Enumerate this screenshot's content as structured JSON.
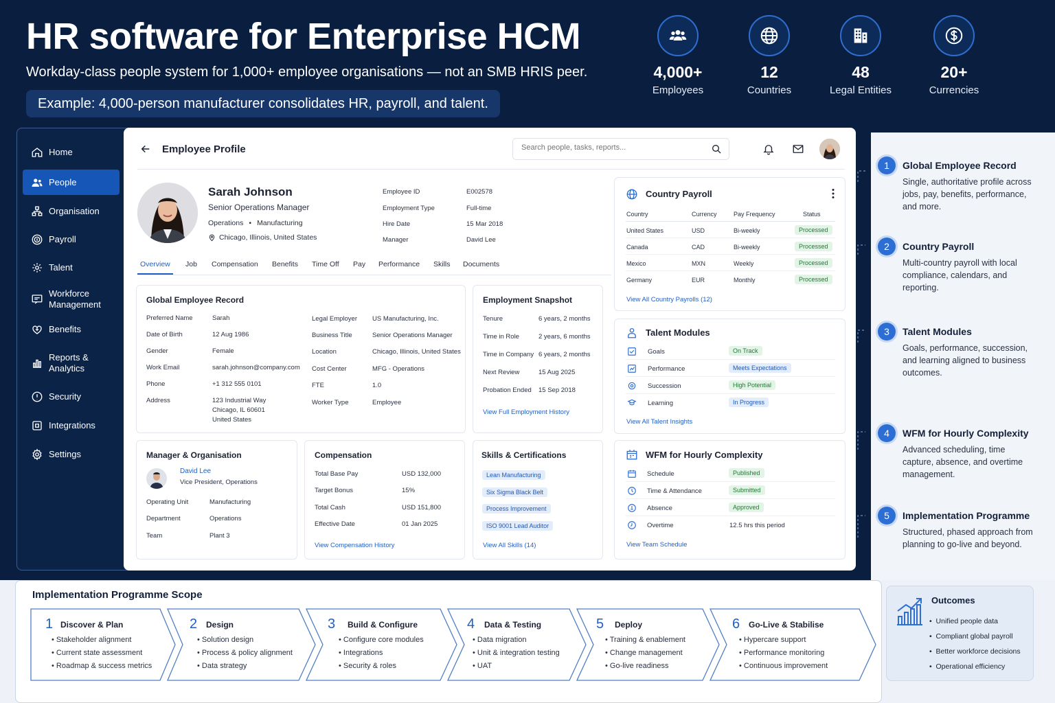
{
  "header": {
    "title": "HR software for Enterprise HCM",
    "subtitle": "Workday-class people system for 1,000+ employee organisations — not an SMB HRIS peer.",
    "example": "Example: 4,000-person manufacturer consolidates HR, payroll, and talent."
  },
  "stats": [
    {
      "value": "4,000+",
      "label": "Employees",
      "icon": "people-icon"
    },
    {
      "value": "12",
      "label": "Countries",
      "icon": "globe-icon"
    },
    {
      "value": "48",
      "label": "Legal Entities",
      "icon": "building-icon"
    },
    {
      "value": "20+",
      "label": "Currencies",
      "icon": "dollar-icon"
    }
  ],
  "sidebar": {
    "items": [
      {
        "label": "Home"
      },
      {
        "label": "People",
        "active": true
      },
      {
        "label": "Organisation"
      },
      {
        "label": "Payroll"
      },
      {
        "label": "Talent"
      },
      {
        "label": "Workforce Management"
      },
      {
        "label": "Benefits"
      },
      {
        "label": "Reports & Analytics"
      },
      {
        "label": "Security"
      },
      {
        "label": "Integrations"
      },
      {
        "label": "Settings"
      }
    ]
  },
  "topbar": {
    "title": "Employee Profile",
    "search_placeholder": "Search people, tasks, reports..."
  },
  "profile": {
    "name": "Sarah Johnson",
    "title": "Senior Operations Manager",
    "dept": "Operations",
    "dept2": "Manufacturing",
    "location": "Chicago, Illinois, United States",
    "fields": [
      {
        "k": "Employee ID",
        "v": "E002578"
      },
      {
        "k": "Employment Type",
        "v": "Full-time"
      },
      {
        "k": "Hire Date",
        "v": "15 Mar 2018"
      },
      {
        "k": "Manager",
        "v": "David Lee"
      }
    ]
  },
  "tabs": [
    "Overview",
    "Job",
    "Compensation",
    "Benefits",
    "Time Off",
    "Pay",
    "Performance",
    "Skills",
    "Documents"
  ],
  "global_record": {
    "title": "Global Employee Record",
    "left": [
      {
        "k": "Preferred Name",
        "v": "Sarah"
      },
      {
        "k": "Date of Birth",
        "v": "12 Aug 1986"
      },
      {
        "k": "Gender",
        "v": "Female"
      },
      {
        "k": "Work Email",
        "v": "sarah.johnson@company.com"
      },
      {
        "k": "Phone",
        "v": "+1 312 555 0101"
      },
      {
        "k": "Address",
        "v": "123 Industrial Way",
        "v2": "Chicago, IL 60601",
        "v3": "United States"
      }
    ],
    "right": [
      {
        "k": "Legal Employer",
        "v": "US Manufacturing, Inc."
      },
      {
        "k": "Business Title",
        "v": "Senior Operations Manager"
      },
      {
        "k": "Location",
        "v": "Chicago, Illinois, United States"
      },
      {
        "k": "Cost Center",
        "v": "MFG - Operations"
      },
      {
        "k": "FTE",
        "v": "1.0"
      },
      {
        "k": "Worker Type",
        "v": "Employee"
      }
    ]
  },
  "snapshot": {
    "title": "Employment Snapshot",
    "rows": [
      {
        "k": "Tenure",
        "v": "6 years, 2 months"
      },
      {
        "k": "Time in Role",
        "v": "2 years, 6 months"
      },
      {
        "k": "Time in Company",
        "v": "6 years, 2 months"
      },
      {
        "k": "Next Review",
        "v": "15 Aug 2025"
      },
      {
        "k": "Probation Ended",
        "v": "15 Sep 2018"
      }
    ],
    "link": "View Full Employment History"
  },
  "payroll": {
    "title": "Country Payroll",
    "headers": [
      "Country",
      "Currency",
      "Pay Frequency",
      "Status"
    ],
    "rows": [
      [
        "United States",
        "USD",
        "Bi-weekly",
        "Processed"
      ],
      [
        "Canada",
        "CAD",
        "Bi-weekly",
        "Processed"
      ],
      [
        "Mexico",
        "MXN",
        "Weekly",
        "Processed"
      ],
      [
        "Germany",
        "EUR",
        "Monthly",
        "Processed"
      ]
    ],
    "link": "View All Country Payrolls (12)"
  },
  "talent": {
    "title": "Talent Modules",
    "rows": [
      {
        "k": "Goals",
        "v": "On Track",
        "c": "green"
      },
      {
        "k": "Performance",
        "v": "Meets Expectations",
        "c": "blue"
      },
      {
        "k": "Succession",
        "v": "High Potential",
        "c": "green"
      },
      {
        "k": "Learning",
        "v": "In Progress",
        "c": "blue"
      }
    ],
    "link": "View All Talent Insights"
  },
  "manager": {
    "title": "Manager & Organisation",
    "name": "David Lee",
    "role": "Vice President, Operations",
    "rows": [
      {
        "k": "Operating Unit",
        "v": "Manufacturing"
      },
      {
        "k": "Department",
        "v": "Operations"
      },
      {
        "k": "Team",
        "v": "Plant 3"
      }
    ]
  },
  "compensation": {
    "title": "Compensation",
    "rows": [
      {
        "k": "Total Base Pay",
        "v": "USD 132,000"
      },
      {
        "k": "Target Bonus",
        "v": "15%"
      },
      {
        "k": "Total Cash",
        "v": "USD 151,800"
      },
      {
        "k": "Effective Date",
        "v": "01 Jan 2025"
      }
    ],
    "link": "View Compensation History"
  },
  "skills": {
    "title": "Skills & Certifications",
    "items": [
      "Lean Manufacturing",
      "Six Sigma Black Belt",
      "Process Improvement",
      "ISO 9001 Lead Auditor"
    ],
    "link": "View All Skills (14)"
  },
  "wfm": {
    "title": "WFM for Hourly Complexity",
    "rows": [
      {
        "k": "Schedule",
        "v": "Published",
        "c": "green"
      },
      {
        "k": "Time & Attendance",
        "v": "Submitted",
        "c": "green"
      },
      {
        "k": "Absence",
        "v": "Approved",
        "c": "green"
      },
      {
        "k": "Overtime",
        "v": "12.5 hrs this period",
        "c": "none"
      }
    ],
    "link": "View Team Schedule"
  },
  "features": [
    {
      "n": "1",
      "title": "Global Employee Record",
      "desc": "Single, authoritative profile across jobs, pay, benefits, performance, and more."
    },
    {
      "n": "2",
      "title": "Country Payroll",
      "desc": "Multi-country payroll with local compliance, calendars, and reporting."
    },
    {
      "n": "3",
      "title": "Talent Modules",
      "desc": "Goals, performance, succession, and learning aligned to business outcomes."
    },
    {
      "n": "4",
      "title": "WFM for Hourly Complexity",
      "desc": "Advanced scheduling, time capture, absence, and overtime management."
    },
    {
      "n": "5",
      "title": "Implementation Programme",
      "desc": "Structured, phased approach from planning to go-live and beyond."
    }
  ],
  "scope": {
    "title": "Implementation Programme  Scope",
    "steps": [
      {
        "n": "1",
        "title": "Discover & Plan",
        "items": [
          "Stakeholder alignment",
          "Current state assessment",
          "Roadmap & success metrics"
        ]
      },
      {
        "n": "2",
        "title": "Design",
        "items": [
          "Solution design",
          "Process & policy alignment",
          "Data strategy"
        ]
      },
      {
        "n": "3",
        "title": "Build & Configure",
        "items": [
          "Configure core modules",
          "Integrations",
          "Security & roles"
        ]
      },
      {
        "n": "4",
        "title": "Data & Testing",
        "items": [
          "Data migration",
          "Unit & integration testing",
          "UAT"
        ]
      },
      {
        "n": "5",
        "title": "Deploy",
        "items": [
          "Training & enablement",
          "Change management",
          "Go-live readiness"
        ]
      },
      {
        "n": "6",
        "title": "Go-Live & Stabilise",
        "items": [
          "Hypercare support",
          "Performance monitoring",
          "Continuous improvement"
        ]
      }
    ]
  },
  "outcomes": {
    "title": "Outcomes",
    "items": [
      "Unified people data",
      "Compliant global payroll",
      "Better workforce decisions",
      "Operational efficiency"
    ]
  },
  "colors": {
    "navy": "#0a1f40",
    "accent": "#2d6ed4",
    "active": "#1656b6",
    "link": "#1f5fc4"
  }
}
